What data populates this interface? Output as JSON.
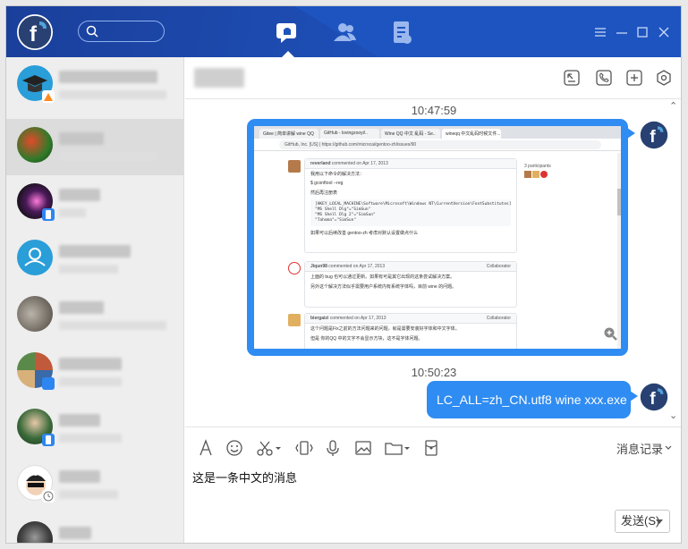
{
  "colors": {
    "titlebar": "#1d54c0",
    "bubble": "#2f8cf2",
    "sidebar_bg": "#eeeeee",
    "selected": "#dcdcdc"
  },
  "title_bar": {
    "logo_icon": "fedora-logo-icon",
    "tabs": [
      {
        "name": "chat",
        "icon": "chat-bubble-icon",
        "active": true
      },
      {
        "name": "contacts",
        "icon": "contacts-icon"
      },
      {
        "name": "documents",
        "icon": "document-icon"
      }
    ],
    "window_buttons": [
      "menu-icon",
      "minimize-icon",
      "maximize-icon",
      "close-icon"
    ]
  },
  "sidebar": {
    "selected_index": 1,
    "conversations": [
      {
        "avatar": "graduation-cap-icon"
      },
      {
        "avatar": "parrot-photo"
      },
      {
        "avatar": "dark-photo",
        "status": "phone"
      },
      {
        "avatar": "group-icon"
      },
      {
        "avatar": "stones-photo"
      },
      {
        "avatar": "collage-photo"
      },
      {
        "avatar": "couple-photo",
        "status": "phone"
      },
      {
        "avatar": "cartoon-roy",
        "status": "clock",
        "avatar_text": "ROY"
      },
      {
        "avatar": "dark-portrait",
        "status": "phone"
      }
    ]
  },
  "chat": {
    "header_icons": [
      "screen-share-icon",
      "phone-icon",
      "add-icon",
      "settings-hex-icon"
    ],
    "messages": [
      {
        "time": "10:47:59",
        "type": "image",
        "image": {
          "browser_tabs": [
            "Gitee | 简单讲解 wine QQ",
            "GitHub - lovingzooyi/..",
            "Wine QQ 中文 乱码 - Se..",
            "wineqq 中文乱码时候文件..."
          ],
          "url": "GitHub, Inc. [US] | https://github.com/microcai/gentoo-zh/issues/90",
          "participants_label": "3 participants",
          "comments": [
            {
              "author": "reverland",
              "meta": "commented on Apr 17, 2013",
              "lines": [
                "我用以下命令的解决方法：",
                "$ gconftool --reg",
                "然后再注册表"
              ],
              "code": "[HKEY_LOCAL_MACHINE\\Software\\Microsoft\\Windows NT\\CurrentVersion\\FontSubstitutes]\n\"MS Shell Dlg\"=\"SimSun\"\n\"MS Shell Dlg 2\"=\"SimSun\"\n\"Tahoma\"=\"SimSun\"",
              "footer": "如果可以后续改善 gentoo-zh 考虑对默认设置做点什么"
            },
            {
              "author": "Jiqun98",
              "meta": "commented on Apr 17, 2013",
              "role": "Collaborator",
              "lines": [
                "上面的 bug 也可以通过更新。如果有可是其它出现的这条尝试解决方案。",
                "另外这个解决方法似乎需要用户系统内有系统字体吗，目前 wine 的问题。"
              ]
            },
            {
              "author": "biergaizi",
              "meta": "commented on Apr 17, 2013",
              "role": "Collaborator",
              "lines": [
                "这个问题是Fix之前的方法问题来的问题，就是需要安装好字体和中文字体。",
                "但是 你的QQ 中的文字不会显示方块，这不是字体问题。"
              ]
            }
          ]
        }
      },
      {
        "time": "10:50:23",
        "type": "text",
        "text": "LC_ALL=zh_CN.utf8 wine xxx.exe"
      }
    ]
  },
  "composer": {
    "tools": [
      "font-icon",
      "emoji-icon",
      "scissors-icon",
      "shake-icon",
      "microphone-icon",
      "image-icon",
      "folder-icon",
      "red-envelope-icon"
    ],
    "history_label": "消息记录",
    "input_value": "这是一条中文的消息",
    "send_label": "发送(S)"
  }
}
